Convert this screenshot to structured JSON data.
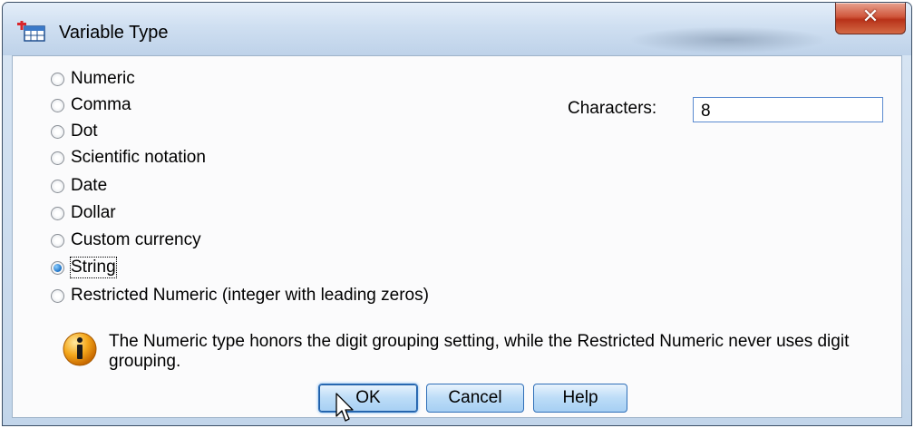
{
  "window": {
    "title": "Variable Type",
    "close_glyph": "✕"
  },
  "types": [
    {
      "label": "Numeric",
      "checked": false
    },
    {
      "label": "Comma",
      "checked": false
    },
    {
      "label": "Dot",
      "checked": false
    },
    {
      "label": "Scientific notation",
      "checked": false
    },
    {
      "label": "Date",
      "checked": false
    },
    {
      "label": "Dollar",
      "checked": false
    },
    {
      "label": "Custom currency",
      "checked": false
    },
    {
      "label": "String",
      "checked": true
    },
    {
      "label": "Restricted Numeric (integer with leading zeros)",
      "checked": false
    }
  ],
  "characters": {
    "label": "Characters:",
    "value": "8"
  },
  "info": {
    "icon": "info-icon",
    "text": "The Numeric type honors the digit grouping setting, while the Restricted Numeric never uses digit grouping."
  },
  "buttons": {
    "ok": "OK",
    "cancel": "Cancel",
    "help": "Help"
  },
  "colors": {
    "accent": "#2f6fb8",
    "close": "#c9452a",
    "info": "#f0a020"
  }
}
